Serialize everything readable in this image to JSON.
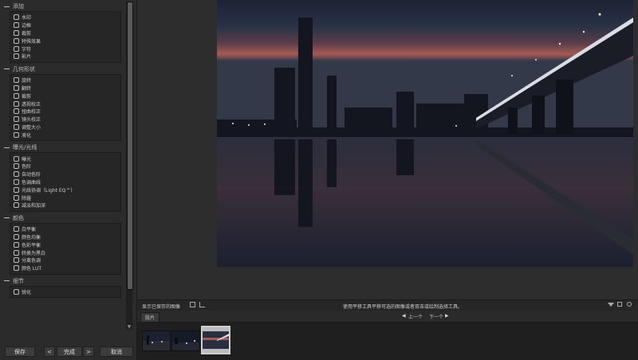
{
  "sidebar": {
    "sections": [
      {
        "title": "添加",
        "items": [
          "水印",
          "边框",
          "裁剪",
          "特殊效果",
          "字符",
          "影片"
        ]
      },
      {
        "title": "几何形状",
        "items": [
          "旋转",
          "翻转",
          "裁剪",
          "透视校正",
          "扭曲校正",
          "镜头校正",
          "调整大小",
          "液化"
        ]
      },
      {
        "title": "曝光/光线",
        "items": [
          "曝光",
          "色阶",
          "自动色阶",
          "色调曲线",
          "光线协调（Light EQ™）",
          "除霾",
          "减淡和加深"
        ]
      },
      {
        "title": "颜色",
        "items": [
          "白平衡",
          "颜色均衡",
          "色彩平衡",
          "转换为黑白",
          "分离色调",
          "颜色 LUT"
        ]
      },
      {
        "title": "细节",
        "items": [
          "锐化"
        ]
      }
    ]
  },
  "buttons": {
    "save": "保存",
    "done": "完成",
    "cancel": "取消",
    "prev_arrow": "<",
    "next_arrow": ">"
  },
  "status": {
    "show_saved": "显示已保存的图像",
    "hint": "使用平移工具平移可选的图像或者双击或绘制选择工具。"
  },
  "filmstrip": {
    "tab": "胶片",
    "prev": "上一个",
    "next": "下一个"
  },
  "colors": {
    "accent": "#5aa0e6",
    "background": "#232323"
  }
}
